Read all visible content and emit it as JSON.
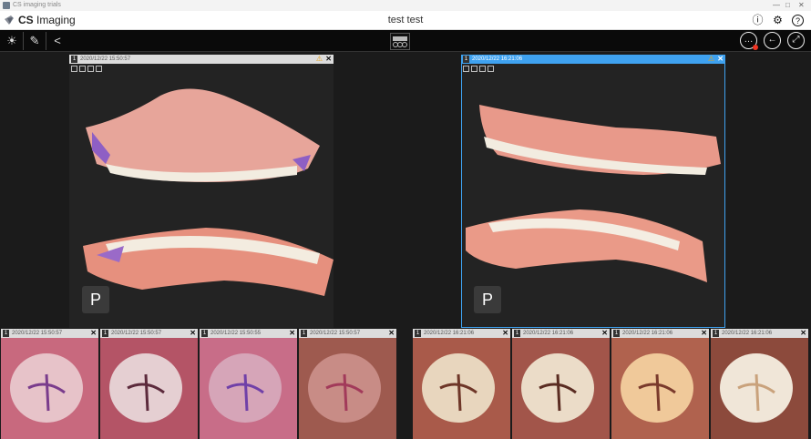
{
  "window": {
    "title": "CS imaging trials",
    "controls": [
      "—",
      "□",
      "✕"
    ]
  },
  "app": {
    "logo_bold": "CS",
    "logo_rest": " Imaging",
    "document_title": "test test"
  },
  "appbar_icons": [
    "info-icon",
    "gear-icon",
    "help-icon"
  ],
  "appbar_glyphs": {
    "info": "ⓘ",
    "gear": "⚙",
    "help": "?"
  },
  "toolbar": {
    "left_glyphs": {
      "brightness": "☀",
      "tools": "✎",
      "share": "<"
    },
    "right_glyphs": {
      "more": "…",
      "back": "←",
      "fullscreen": "⤢"
    }
  },
  "viewers": [
    {
      "number": "1",
      "date": "2020/12/22 15:50:57",
      "warning": "⚠",
      "close": "✕",
      "badge": "P"
    },
    {
      "number": "1",
      "date": "2020/12/22 16:21:06",
      "warning": "⚠",
      "close": "✕",
      "badge": "P"
    }
  ],
  "thumbnails": [
    {
      "number": "1",
      "date": "2020/12/22 15:50:57",
      "close": "✕"
    },
    {
      "number": "1",
      "date": "2020/12/22 15:50:57",
      "close": "✕"
    },
    {
      "number": "1",
      "date": "2020/12/22 15:50:55",
      "close": "✕"
    },
    {
      "number": "1",
      "date": "2020/12/22 15:50:57",
      "close": "✕"
    },
    {
      "number": "1",
      "date": "2020/12/22 16:21:06",
      "close": "✕"
    },
    {
      "number": "1",
      "date": "2020/12/22 16:21:06",
      "close": "✕"
    },
    {
      "number": "1",
      "date": "2020/12/22 16:21:06",
      "close": "✕"
    },
    {
      "number": "1",
      "date": "2020/12/22 16:21:06",
      "close": "✕"
    }
  ],
  "colors": {
    "accent": "#3fa2f0",
    "warning": "#e4a21b",
    "background": "#1b1b1b",
    "toolbar": "#0a0a0a"
  }
}
